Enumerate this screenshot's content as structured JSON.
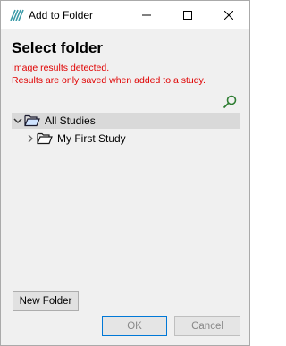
{
  "window": {
    "title": "Add to Folder",
    "controls": {
      "minimize": "minimize-icon",
      "maximize": "maximize-icon",
      "close": "close-icon"
    }
  },
  "dialog": {
    "heading": "Select folder",
    "warning_line1": "Image results detected.",
    "warning_line2": "Results are only saved when added to a study.",
    "warning_color": "#e00000"
  },
  "search": {
    "icon": "search-icon",
    "color": "#2e7d32"
  },
  "tree": {
    "root": {
      "label": "All Studies",
      "expanded": true,
      "selected": true
    },
    "children": [
      {
        "label": "My First Study",
        "expanded": false
      }
    ]
  },
  "buttons": {
    "new_folder": "New Folder",
    "ok": "OK",
    "cancel": "Cancel"
  },
  "colors": {
    "selection": "#d9d9d9",
    "ok_border": "#0078d7",
    "app_icon": "#3a9aa8"
  }
}
